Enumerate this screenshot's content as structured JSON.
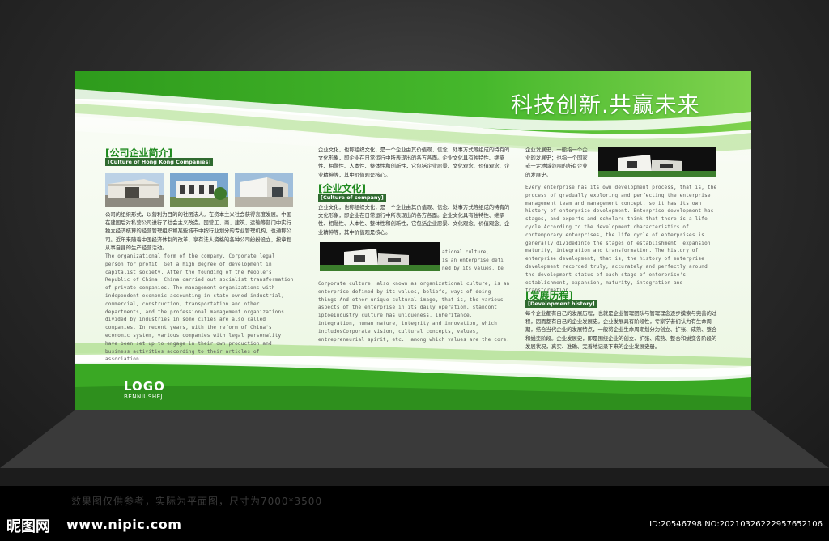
{
  "board": {
    "slogan": "科技创新.共赢未来",
    "logo": "LOGO",
    "logo_sub": "BENNIUSHEJ"
  },
  "section1": {
    "title": "[公司企业简介]",
    "subtitle": "[Culture of Hong Kong Companies]",
    "cn_text": "公司的组织形式，以营利为目的的社团法人。在资本主义社会获得高度发展。中国在建国后对私营公司进行了社会主义改造。国营工、商、建筑、运输等部门中实行独立经济核算的经营管理组织和某些城市中按行业划分的专业管理机构，也通称公司。近年来随着中国经济体制的改革，享有法人资格的各种公司纷纷设立，按章程从事自身的生产经营活动。",
    "en_text": "The organizational form of the company. Corporate legal person for profit. Get a high degree of development in capitalist society. After the founding of the People's Republic of China, China carried out socialist transformation of private companies. The management organizations with independent economic accounting in state-owned industrial, commercial, construction, transportation and other departments, and the professional management organizations divided by industries in some cities are also called companies. In recent years, with the reform of China's economic system, various companies with legal personality have been set up to engage in their own production and business activities according to their articles of association."
  },
  "section2": {
    "intro_cn": "企业文化，也称组织文化，是一个企业由其价值观、信念、处事方式等组成的特有的文化形象，即企业在日常运行中所表现出的各方各面。企业文化具有独特性、继承性、相融性、人本性、整体性和创新性，它包括企业愿景、文化观念、价值观念、企业精神等，其中价值观是核心。",
    "title": "[企业文化]",
    "subtitle": "[Culture of company]",
    "cn_text": "企业文化，也称组织文化，是一个企业由其价值观、信念、处事方式等组成的特有的文化形象，即企业在日常运行中所表现出的各方各面。企业文化具有独特性、继承性、相融性、人本性、整体性和创新性，它包括企业愿景、文化观念、价值观念、企业精神等，其中价值观是核心。",
    "caption_lines": [
      "ational culture,",
      "is an enterprise defi",
      "ned by its values, be"
    ],
    "en_text": "Corporate culture, also known as organizational culture, is an enterprise defined by its values, beliefs, ways of doing things And other unique cultural image, that is, the various aspects of the enterprise in its daily operation. standont iptoeIndustry culture has uniqueness, inheritance, integration, human nature, integrity and innovation, which includesCorporate vision, cultural concepts, values, entrepreneurial spirit, etc., among which values are the core."
  },
  "section3": {
    "intro_cn": "企业发展史，一般指一个企业的发展史；也指一个国家或一定地域范围的所有企业的发展史。",
    "en_text": "Every enterprise has its own development process, that is, the process of gradually exploring and perfecting the enterprise management team and management concept, so it has its own history of enterprise development. Enterprise development has stages, and experts and scholars think that there is a life cycle.According to the development characteristics of contemporary enterprises, the life cycle of enterprises is generally dividedinto the stages of establishment, expansion, maturity, integration and transformation. The history of enterprise development, that is, the history of enterprise development recorded truly, accurately and perfectly around the development status of each stage of enterprise's establishment, expansion, maturity, integration and transformation.",
    "title": "[发展历程]",
    "subtitle": "[Development history]",
    "cn_text": "每个企业都有自己的发展历程，也就是企业管理团队与管理理念逐步摸索与完善的过程，因而都有自己的企业发展史。企业发展具有阶段性，专家学者们认为有生命周期，结合当代企业的发展特点，一般将企业生命周期划分为创立、扩张、成熟、整合和蜕变阶段。企业发展史，即是围绕企业的创立、扩张、成熟、整合和蜕变各阶段的发展状况，真实、准确、完善地记录下来的企业发展史册。"
  },
  "watermark": "效果图仅供参考，实际为平面图，尺寸为7000*3500",
  "footer": {
    "site_logo": "昵图网",
    "site_url": "www.nipic.com",
    "id_text": "ID:20546798 NO:20210326222957652106"
  },
  "colors": {
    "accent": "#3fae2a",
    "dark_green": "#2f6a2f",
    "title_green": "#1f8a1f"
  }
}
